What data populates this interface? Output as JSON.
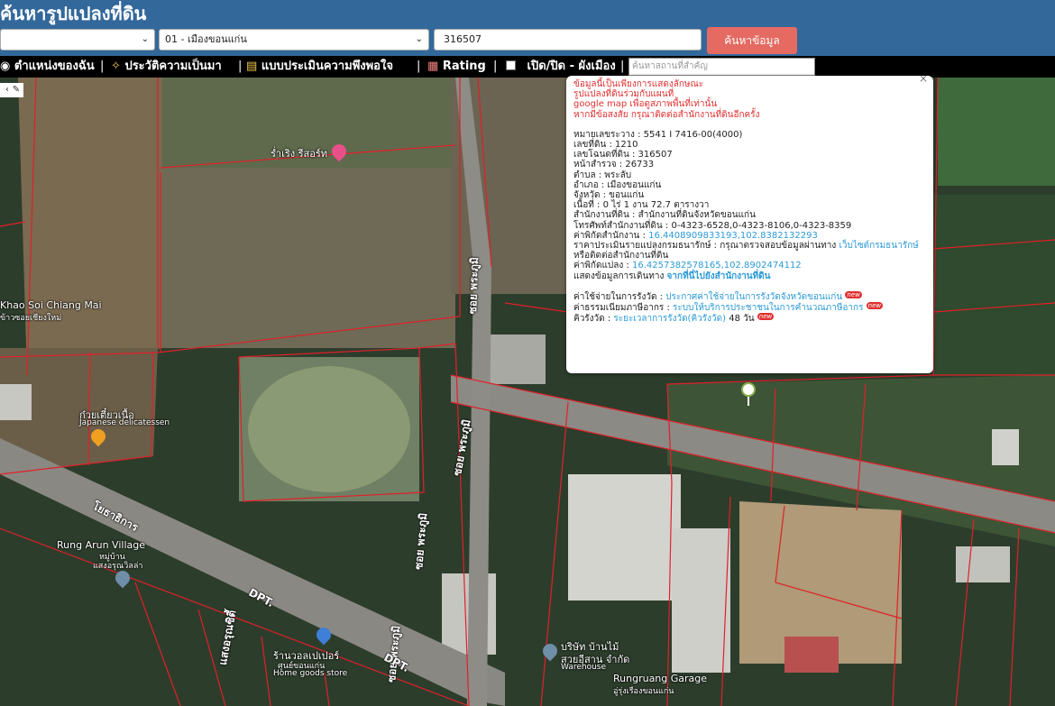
{
  "header": {
    "title": "ค้นหารูปแปลงที่ดิน",
    "province_select": "",
    "district_select": "01 - เมืองขอนแก่น",
    "parcel_input": "316507",
    "search_button": "ค้นหาข้อมูล"
  },
  "toolbar": {
    "my_location": "ตำแหน่งของฉัน",
    "history": "ประวัติความเป็นมา",
    "survey": "แบบประเมินความพึงพอใจ",
    "rating": "Rating",
    "toggle_city_plan": "เปิด/ปิด - ผังเมือง",
    "place_search_placeholder": "ค้นหาสถานที่สำคัญ"
  },
  "popup": {
    "notice": [
      "ข้อมูลนี้เป็นเพียงการแสดงลักษณะ",
      "รูปแปลงที่ดินร่วมกับแผนที่",
      "google map เพื่อดูสภาพพื้นที่เท่านั้น",
      "หากมีข้อสงสัย กรุณาติดต่อสำนักงานที่ดินอีกครั้ง"
    ],
    "fields": {
      "map_sheet": "หมายเลขระวาง : 5541 I 7416-00(4000)",
      "land_no": "เลขที่ดิน : 1210",
      "deed_no": "เลขโฉนดที่ดิน : 316507",
      "survey_page": "หน้าสำรวจ : 26733",
      "subdistrict": "ตำบล : พระลับ",
      "district": "อำเภอ : เมืองขอนแก่น",
      "province": "จังหวัด : ขอนแก่น",
      "area": "เนื้อที่ : 0 ไร่ 1 งาน 72.7 ตารางวา",
      "office": "สำนักงานที่ดิน : สำนักงานที่ดินจังหวัดขอนแก่น",
      "phone": "โทรศัพท์สำนักงานที่ดิน : 0-4323-6528,0-4323-8106,0-4323-8359",
      "office_coord_label": "ค่าพิกัดสำนักงาน : ",
      "office_coord": "16.4408909833193,102.8382132293",
      "appraisal_label": "ราคาประเมินรายแปลงกรมธนารักษ์ : กรุณาตรวจสอบข้อมูลผ่านทาง ",
      "appraisal_link": "เว็บไซต์กรมธนารักษ์",
      "appraisal_tail": "หรือติดต่อสำนักงานที่ดิน",
      "parcel_coord_label": "ค่าพิกัดแปลง : ",
      "parcel_coord": "16.4257382578165,102.8902474112",
      "route_label": "แสดงข้อมูลการเดินทาง ",
      "route_link": "จากที่นี่ไปยังสำนักงานที่ดิน"
    },
    "extra": {
      "fee_label": "ค่าใช้จ่ายในการรังวัด : ",
      "fee_link": "ประกาศค่าใช้จ่ายในการรังวัดจังหวัดขอนแก่น",
      "tax_label": "ค่าธรรมเนียมภาษีอากร : ",
      "tax_link": "ระบบให้บริการประชาชนในการคำนวณภาษีอากร",
      "queue_label": "คิวรังวัด : ",
      "queue_link": "ระยะเวลาการรังวัด(คิวรังวัด)",
      "queue_days": " 48 วัน",
      "new_badge": "new"
    }
  },
  "map_labels": {
    "resort": "ร่ำเริง รีสอร์ท",
    "khao_soi": "Khao Soi Chiang Mai",
    "khao_soi_th": "ข้าวซอยเชียงใหม่",
    "noodle_th": "ก๋วยเตี๋ยวเนื้อ",
    "noodle_en": "Japanese delicatessen",
    "road_phra_phum_1": "ซอย พระภูมิ",
    "road_phra_phum_2": "ซอย พระภูมิ",
    "road_phra_phum_3": "ซอย พระภูมิ",
    "road_phra_phum_4": "ซอย พระภูมิ",
    "road_dpt_1": "DPT.",
    "road_dpt_2": "DPT.",
    "road_thai": "โยธาธิการ",
    "village_en": "Rung Arun Village",
    "village_th1": "หมู่บ้าน",
    "village_th2": "แสงอรุณวิลล่า",
    "store_th1": "ร้านวอลเปเปอร์",
    "store_th2": "ศูนย์ขอนแก่น",
    "store_en": "Home goods store",
    "company_th1": "บริษัท บ้านไม้",
    "company_th2": "สวยอีสาน จำกัด",
    "company_en": "Warehouse",
    "garage_en": "Rungruang Garage",
    "garage_th": "อู่รุ่งเรืองขอนแก่น",
    "road_saeng": "แสงอรุณซิตี้"
  },
  "colors": {
    "header_bg": "#33689b",
    "search_btn": "#e46a62",
    "parcel_line": "#e0202a",
    "link": "#2c9ad6",
    "warning": "#e03030"
  }
}
